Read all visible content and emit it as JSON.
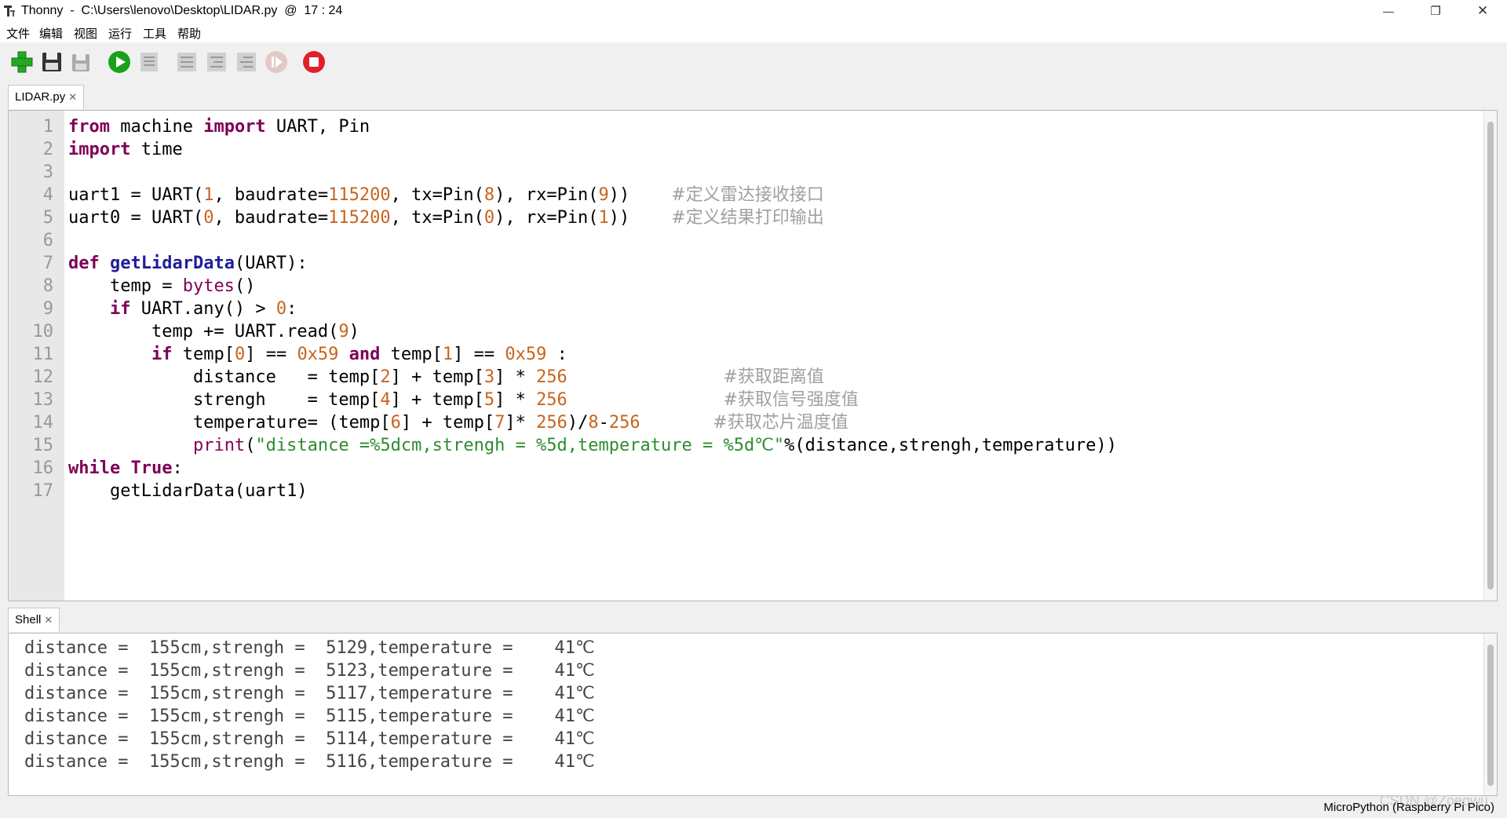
{
  "window": {
    "title": "Thonny  -  C:\\Users\\lenovo\\Desktop\\LIDAR.py  @  17 : 24",
    "controls": {
      "minimize": "—",
      "restore": "❐",
      "close": "✕"
    }
  },
  "menubar": {
    "items": [
      "文件",
      "编辑",
      "视图",
      "运行",
      "工具",
      "帮助"
    ]
  },
  "toolbar": {
    "buttons": [
      "new-file-icon",
      "save-icon",
      "save-as-icon",
      "run-icon",
      "debug-icon",
      "step-over-icon",
      "step-into-icon",
      "step-out-icon",
      "resume-icon",
      "stop-icon"
    ],
    "colors": {
      "run": "#1aa11a",
      "stop": "#e0202a",
      "new": "#22aa22"
    }
  },
  "editor": {
    "tab": {
      "label": "LIDAR.py",
      "close": "✕"
    },
    "line_numbers": [
      "1",
      "2",
      "3",
      "4",
      "5",
      "6",
      "7",
      "8",
      "9",
      "10",
      "11",
      "12",
      "13",
      "14",
      "15",
      "16",
      "17"
    ],
    "lines": [
      "from machine import UART, Pin",
      "import time",
      "",
      "uart1 = UART(1, baudrate=115200, tx=Pin(8), rx=Pin(9))    #定义雷达接收接口",
      "uart0 = UART(0, baudrate=115200, tx=Pin(0), rx=Pin(1))    #定义结果打印输出",
      "",
      "def getLidarData(UART):",
      "    temp = bytes()",
      "    if UART.any() > 0:",
      "        temp += UART.read(9)",
      "        if temp[0] == 0x59 and temp[1] == 0x59 :",
      "            distance   = temp[2] + temp[3] * 256               #获取距离值",
      "            strengh    = temp[4] + temp[5] * 256               #获取信号强度值",
      "            temperature= (temp[6] + temp[7]* 256)/8-256       #获取芯片温度值",
      "            print(\"distance =%5dcm,strengh = %5d,temperature = %5d℃\"%(distance,strengh,temperature))",
      "while True:",
      "    getLidarData(uart1)"
    ]
  },
  "shell": {
    "tab": {
      "label": "Shell",
      "close": "✕"
    },
    "lines": [
      "distance =  155cm,strengh =  5129,temperature =    41℃",
      "distance =  155cm,strengh =  5123,temperature =    41℃",
      "distance =  155cm,strengh =  5117,temperature =    41℃",
      "distance =  155cm,strengh =  5115,temperature =    41℃",
      "distance =  155cm,strengh =  5114,temperature =    41℃",
      "distance =  155cm,strengh =  5116,temperature =    41℃"
    ]
  },
  "statusbar": {
    "interpreter": "MicroPython (Raspberry Pi Pico)",
    "watermark": "CSDN @Zoeqwu"
  }
}
